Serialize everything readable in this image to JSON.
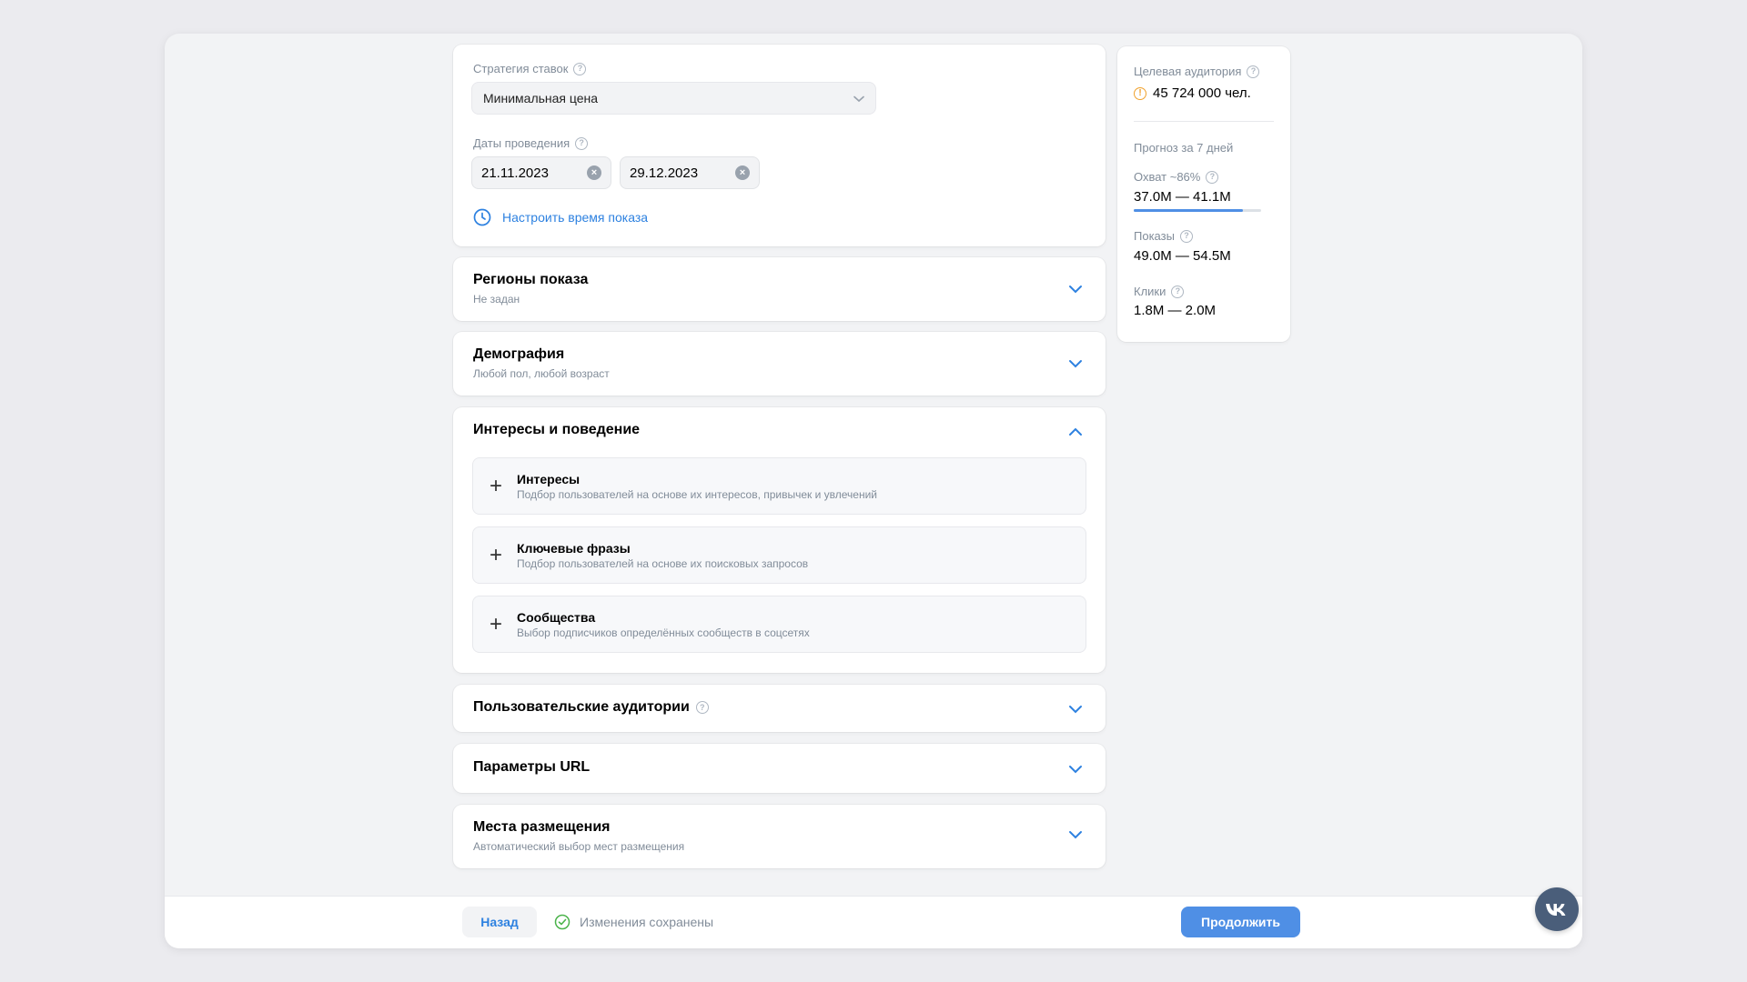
{
  "bidding": {
    "strategy_label": "Стратегия ставок",
    "strategy_value": "Минимальная цена",
    "dates_label": "Даты проведения",
    "date_start": "21.11.2023",
    "date_end": "29.12.2023",
    "schedule_link": "Настроить время показа"
  },
  "sections": {
    "regions": {
      "title": "Регионы показа",
      "subtitle": "Не задан"
    },
    "demography": {
      "title": "Демография",
      "subtitle": "Любой пол, любой возраст"
    },
    "interests": {
      "title": "Интересы и поведение",
      "items": [
        {
          "title": "Интересы",
          "desc": "Подбор пользователей на основе их интересов, привычек и увлечений"
        },
        {
          "title": "Ключевые фразы",
          "desc": "Подбор пользователей на основе их поисковых запросов"
        },
        {
          "title": "Сообщества",
          "desc": "Выбор подписчиков определённых сообществ в соцсетях"
        }
      ]
    },
    "custom_audiences": {
      "title": "Пользовательские аудитории"
    },
    "url_params": {
      "title": "Параметры URL"
    },
    "placements": {
      "title": "Места размещения",
      "subtitle": "Автоматический выбор мест размещения"
    }
  },
  "stats": {
    "audience_label": "Целевая аудитория",
    "audience_value": "45 724 000 чел.",
    "forecast_label": "Прогноз за 7 дней",
    "reach_label": "Охват ~86%",
    "reach_value": "37.0M — 41.1M",
    "reach_bar_percent": 86,
    "impressions_label": "Показы",
    "impressions_value": "49.0M — 54.5M",
    "clicks_label": "Клики",
    "clicks_value": "1.8M — 2.0M"
  },
  "footer": {
    "back_label": "Назад",
    "saved_status": "Изменения сохранены",
    "continue_label": "Продолжить"
  },
  "colors": {
    "accent": "#2d81e0",
    "primary_button": "#4f8fe5",
    "warning": "#f0a12c",
    "success": "#4bb34b",
    "vk_badge": "#4a5e7a"
  }
}
